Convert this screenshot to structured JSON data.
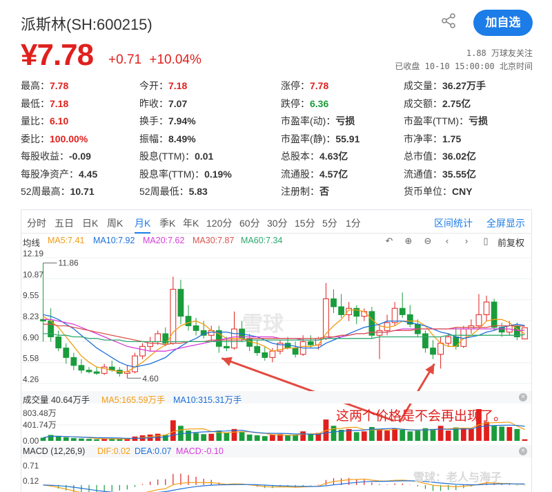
{
  "stock": {
    "title": "派斯林(SH:600215)",
    "price": "¥7.78",
    "change": "+0.71",
    "change_pct": "+10.04%",
    "followers": "1.88 万球友关注",
    "status": "已收盘 10-10 15:00:00 北京时间",
    "follow_label": "加自选"
  },
  "stats": [
    {
      "label": "最高：",
      "value": "7.78",
      "color": "red"
    },
    {
      "label": "今开：",
      "value": "7.18",
      "color": "red"
    },
    {
      "label": "涨停：",
      "value": "7.78",
      "color": "red"
    },
    {
      "label": "成交量：",
      "value": "36.27万手",
      "color": ""
    },
    {
      "label": "最低：",
      "value": "7.18",
      "color": "red"
    },
    {
      "label": "昨收：",
      "value": "7.07",
      "color": ""
    },
    {
      "label": "跌停：",
      "value": "6.36",
      "color": "green"
    },
    {
      "label": "成交额：",
      "value": "2.75亿",
      "color": ""
    },
    {
      "label": "量比：",
      "value": "6.10",
      "color": "red"
    },
    {
      "label": "换手：",
      "value": "7.94%",
      "color": ""
    },
    {
      "label": "市盈率(动)：",
      "value": "亏损",
      "color": ""
    },
    {
      "label": "市盈率(TTM)：",
      "value": "亏损",
      "color": ""
    },
    {
      "label": "委比：",
      "value": "100.00%",
      "color": "red"
    },
    {
      "label": "振幅：",
      "value": "8.49%",
      "color": ""
    },
    {
      "label": "市盈率(静)：",
      "value": "55.91",
      "color": ""
    },
    {
      "label": "市净率：",
      "value": "1.75",
      "color": ""
    },
    {
      "label": "每股收益：",
      "value": "-0.09",
      "color": ""
    },
    {
      "label": "股息(TTM)：",
      "value": "0.01",
      "color": ""
    },
    {
      "label": "总股本：",
      "value": "4.63亿",
      "color": ""
    },
    {
      "label": "总市值：",
      "value": "36.02亿",
      "color": ""
    },
    {
      "label": "每股净资产：",
      "value": "4.45",
      "color": ""
    },
    {
      "label": "股息率(TTM)：",
      "value": "0.19%",
      "color": ""
    },
    {
      "label": "流通股：",
      "value": "4.57亿",
      "color": ""
    },
    {
      "label": "流通值：",
      "value": "35.55亿",
      "color": ""
    },
    {
      "label": "52周最高：",
      "value": "10.71",
      "color": ""
    },
    {
      "label": "52周最低：",
      "value": "5.83",
      "color": ""
    },
    {
      "label": "注册制：",
      "value": "否",
      "color": ""
    },
    {
      "label": "货币单位：",
      "value": "CNY",
      "color": ""
    }
  ],
  "tabs": [
    "分时",
    "五日",
    "日K",
    "周K",
    "月K",
    "季K",
    "年K",
    "120分",
    "60分",
    "30分",
    "15分",
    "5分",
    "1分"
  ],
  "active_tab": "月K",
  "tab_actions": {
    "interval": "区间统计",
    "fullscreen": "全屏显示"
  },
  "ma_legend": {
    "label": "均线",
    "ma5": "MA5:7.41",
    "ma10": "MA10:7.92",
    "ma20": "MA20:7.62",
    "ma30": "MA30:7.87",
    "ma60": "MA60:7.34"
  },
  "adjust_label": "前复权",
  "price_axis": [
    "12.19",
    "10.87",
    "9.55",
    "8.23",
    "6.90",
    "5.58",
    "4.26"
  ],
  "annotations": {
    "high": "11.86",
    "low": "4.60",
    "note": "这两个价格是不会再出现了。",
    "watermark": "雪球",
    "watermark2": "雪球：老人与海子"
  },
  "volume_legend": {
    "label": "成交量 40.64万手",
    "ma5": "MA5:165.59万手",
    "ma10": "MA10:315.31万手"
  },
  "volume_axis": [
    "803.48万",
    "401.74万",
    "0.00"
  ],
  "macd_legend": {
    "label": "MACD (12,26,9)",
    "dif": "DIF:0.02",
    "dea": "DEA:0.07",
    "macd": "MACD:-0.10"
  },
  "macd_axis": [
    "0.71",
    "0.12"
  ],
  "colors": {
    "up": "#e0201d",
    "down": "#1a9c3c",
    "accent": "#1c7ce8",
    "ma5": "#f39c12",
    "ma10": "#1c6fd8",
    "ma20": "#d63ad8",
    "ma30": "#d9534f",
    "ma60": "#2aa86b"
  },
  "chart_data": {
    "type": "candlestick",
    "price_range": [
      4.26,
      12.19
    ],
    "candles": [
      [
        8.3,
        11.86,
        6.9,
        8.2
      ],
      [
        8.2,
        9.0,
        6.9,
        7.2
      ],
      [
        7.2,
        7.6,
        6.3,
        6.5
      ],
      [
        6.5,
        6.8,
        5.5,
        5.9
      ],
      [
        5.9,
        6.2,
        5.1,
        5.4
      ],
      [
        5.4,
        5.8,
        4.9,
        5.1
      ],
      [
        5.1,
        5.3,
        4.9,
        5.0
      ],
      [
        5.0,
        5.3,
        4.8,
        4.9
      ],
      [
        4.9,
        5.5,
        4.8,
        5.3
      ],
      [
        5.3,
        5.7,
        5.0,
        5.1
      ],
      [
        5.1,
        5.3,
        4.7,
        4.9
      ],
      [
        4.9,
        5.4,
        4.6,
        5.0
      ],
      [
        5.0,
        6.2,
        4.9,
        6.0
      ],
      [
        6.0,
        6.8,
        5.8,
        6.6
      ],
      [
        6.6,
        7.2,
        6.3,
        6.9
      ],
      [
        6.9,
        7.6,
        6.7,
        7.4
      ],
      [
        7.4,
        7.8,
        6.6,
        6.8
      ],
      [
        6.8,
        11.0,
        6.7,
        10.2
      ],
      [
        10.2,
        10.8,
        8.0,
        8.5
      ],
      [
        8.5,
        9.2,
        7.6,
        7.9
      ],
      [
        7.9,
        8.4,
        7.3,
        7.6
      ],
      [
        7.6,
        8.2,
        7.1,
        7.3
      ],
      [
        7.3,
        7.9,
        6.9,
        7.6
      ],
      [
        7.6,
        7.9,
        6.2,
        6.6
      ],
      [
        6.6,
        7.2,
        6.3,
        6.5
      ],
      [
        6.5,
        8.8,
        6.4,
        7.7
      ],
      [
        7.7,
        8.2,
        6.9,
        7.1
      ],
      [
        7.1,
        7.4,
        6.3,
        6.6
      ],
      [
        6.6,
        7.0,
        6.0,
        6.2
      ],
      [
        6.2,
        6.6,
        5.7,
        5.9
      ],
      [
        5.9,
        6.5,
        5.6,
        6.3
      ],
      [
        6.3,
        7.0,
        6.1,
        6.8
      ],
      [
        6.8,
        7.2,
        6.4,
        6.5
      ],
      [
        6.5,
        6.9,
        5.9,
        6.1
      ],
      [
        6.1,
        7.3,
        6.0,
        6.9
      ],
      [
        6.9,
        7.3,
        6.5,
        6.7
      ],
      [
        6.7,
        7.2,
        6.4,
        7.1
      ],
      [
        7.1,
        10.6,
        7.0,
        9.6
      ],
      [
        9.6,
        10.2,
        8.7,
        9.1
      ],
      [
        9.1,
        9.9,
        8.4,
        8.6
      ],
      [
        8.6,
        9.4,
        8.2,
        9.0
      ],
      [
        9.0,
        9.2,
        8.0,
        8.5
      ],
      [
        8.5,
        9.0,
        8.2,
        8.8
      ],
      [
        8.8,
        9.1,
        7.1,
        7.3
      ],
      [
        7.3,
        8.0,
        5.8,
        7.6
      ],
      [
        7.6,
        8.6,
        7.3,
        8.1
      ],
      [
        8.1,
        9.4,
        7.9,
        9.0
      ],
      [
        9.0,
        10.0,
        8.4,
        8.6
      ],
      [
        8.6,
        9.2,
        7.8,
        8.0
      ],
      [
        8.0,
        8.3,
        7.2,
        7.4
      ],
      [
        7.4,
        7.6,
        6.2,
        6.5
      ],
      [
        6.5,
        7.0,
        5.8,
        6.1
      ],
      [
        6.1,
        7.2,
        5.2,
        6.8
      ],
      [
        6.8,
        7.4,
        6.6,
        7.2
      ],
      [
        7.2,
        7.8,
        6.4,
        6.6
      ],
      [
        6.6,
        7.9,
        6.5,
        7.7
      ],
      [
        7.7,
        8.3,
        7.4,
        7.9
      ],
      [
        7.9,
        9.9,
        7.8,
        8.6
      ],
      [
        8.6,
        9.8,
        8.2,
        9.4
      ],
      [
        9.4,
        9.6,
        7.6,
        7.8
      ],
      [
        7.8,
        8.1,
        7.2,
        7.5
      ],
      [
        7.5,
        8.2,
        7.3,
        7.9
      ],
      [
        7.9,
        8.1,
        7.0,
        7.2
      ],
      [
        7.07,
        7.78,
        7.18,
        7.78
      ]
    ],
    "ma5": [
      8.5,
      8.2,
      7.8,
      7.2,
      6.6,
      6.0,
      5.6,
      5.3,
      5.2,
      5.1,
      5.0,
      5.0,
      5.3,
      5.6,
      6.0,
      6.4,
      6.7,
      7.5,
      7.9,
      8.1,
      8.2,
      8.0,
      7.6,
      7.4,
      7.1,
      7.1,
      7.1,
      6.9,
      6.8,
      6.6,
      6.3,
      6.4,
      6.5,
      6.5,
      6.6,
      6.6,
      6.7,
      7.4,
      7.9,
      8.3,
      8.9,
      8.9,
      8.8,
      8.3,
      7.9,
      7.8,
      7.9,
      8.2,
      8.2,
      8.2,
      7.9,
      7.3,
      6.8,
      6.6,
      6.6,
      7.1,
      7.3,
      7.7,
      8.2,
      8.3,
      8.3,
      8.1,
      7.7,
      7.4
    ],
    "ma10": [
      8.6,
      8.5,
      8.3,
      8.0,
      7.7,
      7.3,
      6.9,
      6.5,
      6.2,
      5.9,
      5.6,
      5.4,
      5.3,
      5.4,
      5.5,
      5.7,
      5.9,
      6.3,
      6.6,
      6.9,
      7.1,
      7.4,
      7.5,
      7.5,
      7.5,
      7.4,
      7.4,
      7.3,
      7.2,
      7.0,
      6.8,
      6.7,
      6.7,
      6.6,
      6.5,
      6.5,
      6.5,
      6.8,
      7.0,
      7.2,
      7.4,
      7.6,
      7.8,
      7.9,
      8.0,
      8.2,
      8.2,
      8.2,
      8.1,
      8.0,
      7.9,
      7.7,
      7.5,
      7.4,
      7.2,
      7.1,
      7.2,
      7.3,
      7.5,
      7.6,
      7.8,
      7.9,
      8.0,
      7.92
    ],
    "ma20": [
      8.3,
      8.3,
      8.2,
      8.1,
      8.0,
      7.8,
      7.6,
      7.4,
      7.2,
      7.0,
      6.8,
      6.6,
      6.5,
      6.4,
      6.3,
      6.3,
      6.3,
      6.4,
      6.5,
      6.6,
      6.7,
      6.8,
      6.9,
      7.0,
      7.1,
      7.2,
      7.2,
      7.2,
      7.2,
      7.2,
      7.2,
      7.1,
      7.1,
      7.1,
      7.0,
      7.0,
      7.0,
      7.1,
      7.2,
      7.2,
      7.3,
      7.4,
      7.4,
      7.5,
      7.5,
      7.5,
      7.6,
      7.7,
      7.7,
      7.7,
      7.7,
      7.7,
      7.7,
      7.7,
      7.7,
      7.7,
      7.7,
      7.7,
      7.7,
      7.7,
      7.7,
      7.7,
      7.6,
      7.62
    ],
    "ma30": [
      8.0,
      8.0,
      7.9,
      7.9,
      7.8,
      7.7,
      7.6,
      7.5,
      7.4,
      7.3,
      7.2,
      7.1,
      7.0,
      6.9,
      6.8,
      6.8,
      6.7,
      6.8,
      6.8,
      6.9,
      6.9,
      6.9,
      7.0,
      7.0,
      7.0,
      7.0,
      7.0,
      7.1,
      7.1,
      7.1,
      7.1,
      7.1,
      7.1,
      7.1,
      7.1,
      7.1,
      7.1,
      7.2,
      7.2,
      7.3,
      7.3,
      7.4,
      7.4,
      7.5,
      7.5,
      7.5,
      7.6,
      7.6,
      7.6,
      7.7,
      7.7,
      7.7,
      7.7,
      7.7,
      7.8,
      7.8,
      7.8,
      7.8,
      7.8,
      7.9,
      7.9,
      7.9,
      7.9,
      7.87
    ],
    "ma60": [
      7.4,
      7.4,
      7.3,
      7.3,
      7.2,
      7.2,
      7.1,
      7.1,
      7.0,
      7.0,
      7.0,
      6.9,
      6.9,
      6.9,
      6.9,
      6.9,
      6.9,
      6.9,
      6.9,
      6.9,
      6.9,
      6.9,
      6.9,
      6.9,
      6.9,
      6.9,
      6.9,
      7.0,
      7.0,
      7.0,
      7.0,
      7.0,
      7.0,
      7.0,
      7.0,
      7.0,
      7.0,
      7.1,
      7.1,
      7.1,
      7.1,
      7.1,
      7.1,
      7.1,
      7.2,
      7.2,
      7.2,
      7.2,
      7.2,
      7.2,
      7.2,
      7.2,
      7.2,
      7.3,
      7.3,
      7.3,
      7.3,
      7.3,
      7.3,
      7.3,
      7.3,
      7.3,
      7.3,
      7.34
    ],
    "volume": [
      80,
      150,
      120,
      90,
      70,
      60,
      50,
      40,
      55,
      60,
      45,
      50,
      110,
      140,
      160,
      180,
      150,
      520,
      380,
      260,
      200,
      170,
      180,
      260,
      200,
      300,
      220,
      160,
      140,
      120,
      150,
      170,
      140,
      150,
      240,
      180,
      200,
      540,
      380,
      280,
      300,
      220,
      240,
      350,
      300,
      260,
      310,
      280,
      240,
      260,
      320,
      300,
      380,
      260,
      340,
      330,
      300,
      803,
      480,
      380,
      360,
      350,
      300,
      40.64
    ],
    "volume_range": [
      0,
      803.48
    ],
    "macd_range": [
      -0.2,
      0.71
    ]
  }
}
